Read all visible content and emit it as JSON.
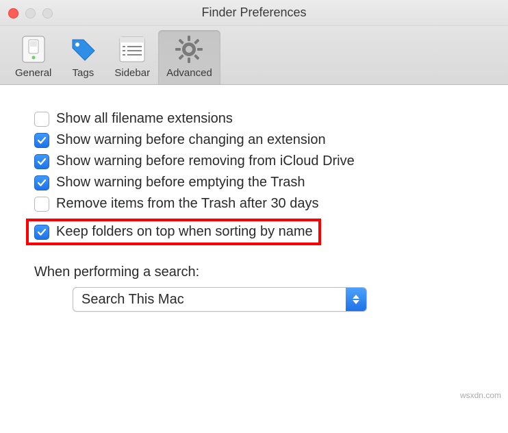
{
  "window": {
    "title": "Finder Preferences"
  },
  "toolbar": {
    "tabs": [
      {
        "label": "General",
        "icon": "switch-icon",
        "selected": false
      },
      {
        "label": "Tags",
        "icon": "tag-icon",
        "selected": false
      },
      {
        "label": "Sidebar",
        "icon": "list-icon",
        "selected": false
      },
      {
        "label": "Advanced",
        "icon": "gear-icon",
        "selected": true
      }
    ]
  },
  "options": [
    {
      "checked": false,
      "label": "Show all filename extensions"
    },
    {
      "checked": true,
      "label": "Show warning before changing an extension"
    },
    {
      "checked": true,
      "label": "Show warning before removing from iCloud Drive"
    },
    {
      "checked": true,
      "label": "Show warning before emptying the Trash"
    },
    {
      "checked": false,
      "label": "Remove items from the Trash after 30 days"
    },
    {
      "checked": true,
      "label": "Keep folders on top when sorting by name",
      "highlighted": true
    }
  ],
  "search": {
    "section_label": "When performing a search:",
    "value": "Search This Mac"
  },
  "watermark": "wsxdn.com"
}
